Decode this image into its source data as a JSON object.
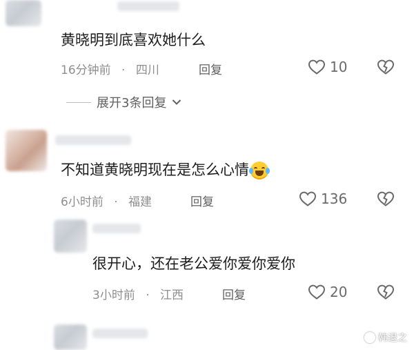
{
  "comments": [
    {
      "text": "黄晓明到底喜欢她什么",
      "time": "16分钟前",
      "location": "四川",
      "reply_label": "回复",
      "likes": "10",
      "expand_label": "展开3条回复"
    },
    {
      "text": "不知道黄晓明现在是怎么心情",
      "emoji": "laughing-crying-emoji",
      "time": "6小时前",
      "location": "福建",
      "reply_label": "回复",
      "likes": "136"
    },
    {
      "text": "很开心，还在老公爱你爱你爱你",
      "time": "3小时前",
      "location": "江西",
      "reply_label": "回复",
      "likes": "20"
    }
  ],
  "separator": "·",
  "watermark": "韩退之",
  "colors": {
    "meta": "#8e8e8e",
    "text": "#1c1c1c",
    "icon": "#6a6a6a"
  },
  "icons": {
    "like": "heart-outline-icon",
    "dislike": "broken-heart-icon",
    "expand": "chevron-down-icon"
  }
}
